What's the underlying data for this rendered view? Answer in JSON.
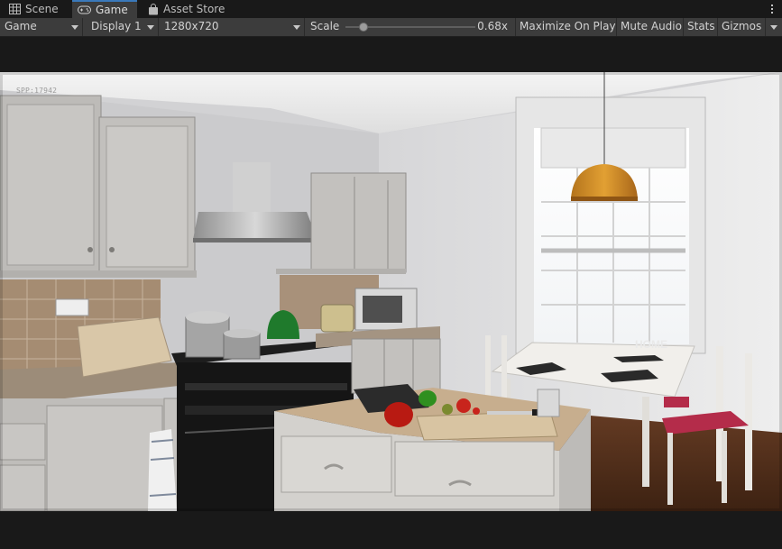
{
  "tabs": [
    {
      "label": "Scene",
      "icon": "scene-grid-icon",
      "active": false
    },
    {
      "label": "Game",
      "icon": "gamepad-icon",
      "active": true
    },
    {
      "label": "Asset Store",
      "icon": "shopping-bag-icon",
      "active": false
    }
  ],
  "tab_menu_icon": "kebab-menu-icon",
  "toolbar": {
    "display_mode": "Game",
    "display": "Display 1",
    "resolution": "1280x720",
    "scale_label": "Scale",
    "scale_value_text": "0.68x",
    "scale_value": 0.68,
    "scale_range": [
      0.25,
      4.0
    ],
    "maximize_label": "Maximize On Play",
    "mute_label": "Mute Audio",
    "stats_label": "Stats",
    "gizmos_label": "Gizmos"
  },
  "viewport": {
    "overlay_text": "SPP:17942",
    "scene_description_icon": "kitchen-render-image",
    "sign_text": "HOME"
  },
  "colors": {
    "tab_active_accent": "#3a79bb",
    "toolbar_bg": "#3c3c3c",
    "editor_bg": "#191919"
  }
}
